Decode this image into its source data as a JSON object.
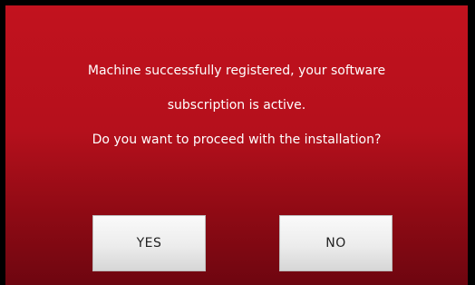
{
  "dialog": {
    "message_lines": [
      "Machine successfully registered, your software",
      "subscription is active.",
      "Do you want to proceed with the installation?"
    ],
    "yes_label": "YES",
    "no_label": "NO"
  },
  "colors": {
    "background_top": "#c2121e",
    "background_bottom": "#6e0610",
    "text": "#ffffff",
    "button_face": "#ececec",
    "button_text": "#222222"
  }
}
